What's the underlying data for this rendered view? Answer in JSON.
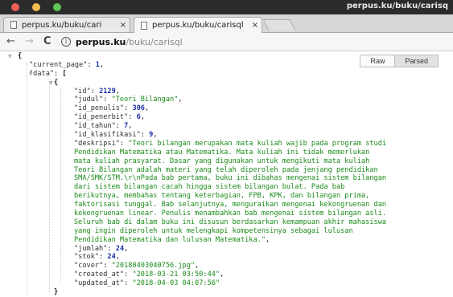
{
  "window": {
    "title": "perpus.ku/buku/carisq"
  },
  "tabs": [
    {
      "label": "perpus.ku/buku/cari",
      "close": "×"
    },
    {
      "label": "perpus.ku/buku/carisql",
      "close": "×"
    }
  ],
  "address": {
    "host": "perpus.ku",
    "path": "/buku/carisql"
  },
  "viewer": {
    "raw_label": "Raw",
    "parsed_label": "Parsed",
    "selected": "Parsed"
  },
  "json": {
    "open_brace": "{",
    "current_page_key": "\"current_page\"",
    "current_page_value": "1",
    "data_key": "\"data\"",
    "data_open": "[",
    "item_open": "{",
    "id_key": "\"id\"",
    "id_value": "2129",
    "judul_key": "\"judul\"",
    "judul_value": "\"Teori Bilangan\"",
    "id_penulis_key": "\"id_penulis\"",
    "id_penulis_value": "306",
    "id_penerbit_key": "\"id_penerbit\"",
    "id_penerbit_value": "6",
    "id_tahun_key": "\"id_tahun\"",
    "id_tahun_value": "7",
    "id_klasifikasi_key": "\"id_klasifikasi\"",
    "id_klasifikasi_value": "9",
    "deskripsi_key": "\"deskripsi\"",
    "deskripsi_lines": [
      "\"Teori bilangan merupakan mata kuliah wajib pada program studi",
      "Pendidikan Matematika atau Matematika. Mata kuliah ini tidak memerlukan",
      "mata kuliah prasyarat. Dasar yang digunakan untuk mengikuti mata kuliah",
      "Teori Bilangan adalah materi yang telah diperoleh pada jenjang pendidikan",
      "SMA/SMK/STM.\\r\\nPada bab pertama, buku ini dibahas mengenai sistem bilangan",
      "dari sistem bilangan cacah hingga sistem bilangan bulat. Pada bab",
      "berikutnya, membahas tentang keterbagian, FPB, KPK, dan bilangan prima,",
      "faktorisasi tunggal. Bab selanjutnya, menguraikan mengenai kekongruenan dan",
      "kekongruenan linear. Penulis menambahkan bab mengenai sistem bilangan asli.",
      "Seluruh bab di dalam buku ini disusun berdasarkan kemampuan akhir mahasiswa",
      "yang ingin diperoleh untuk melengkapi kompetensinya sebagai lulusan",
      "Pendidikan Matematika dan lulusan Matematika.\""
    ],
    "jumlah_key": "\"jumlah\"",
    "jumlah_value": "24",
    "stok_key": "\"stok\"",
    "stok_value": "24",
    "cover_key": "\"cover\"",
    "cover_value": "\"20180403040756.jpg\"",
    "created_at_key": "\"created_at\"",
    "created_at_value": "\"2018-03-21 03:50:44\"",
    "updated_at_key": "\"updated_at\"",
    "updated_at_value": "\"2018-04-03 04:07:56\"",
    "item_close": "}",
    "data_close": "],"
  },
  "colors": {
    "string": "#1a8b1a",
    "number": "#1b2fa8",
    "titlebar": "#2b2b2b"
  }
}
